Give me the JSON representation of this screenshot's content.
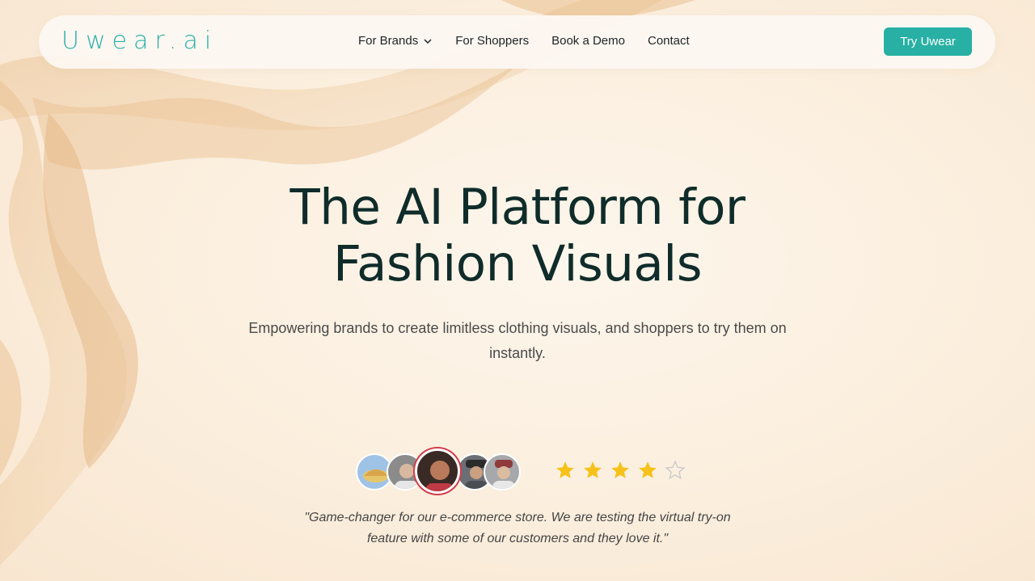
{
  "header": {
    "logo": "Uwear.ai",
    "nav": [
      {
        "label": "For Brands",
        "has_dropdown": true
      },
      {
        "label": "For Shoppers",
        "has_dropdown": false
      },
      {
        "label": "Book a Demo",
        "has_dropdown": false
      },
      {
        "label": "Contact",
        "has_dropdown": false
      }
    ],
    "cta_label": "Try Uwear"
  },
  "hero": {
    "title_line1": "The AI Platform for",
    "title_line2": "Fashion Visuals",
    "subtitle": "Empowering brands to create limitless clothing visuals, and shoppers to try them on instantly."
  },
  "testimonial": {
    "rating": 4,
    "rating_max": 5,
    "quote_line1": "\"Game-changer for our e-commerce store. We are testing the virtual try-on",
    "quote_line2": "feature with some of our customers and they love it.\""
  },
  "colors": {
    "accent": "#27b0a3",
    "title": "#0f2c2a",
    "star": "#f6c21a",
    "background": "#fbeedd"
  },
  "icons": {
    "dropdown": "chevron-down-icon",
    "star_filled": "star-filled-icon",
    "star_empty": "star-empty-icon"
  }
}
